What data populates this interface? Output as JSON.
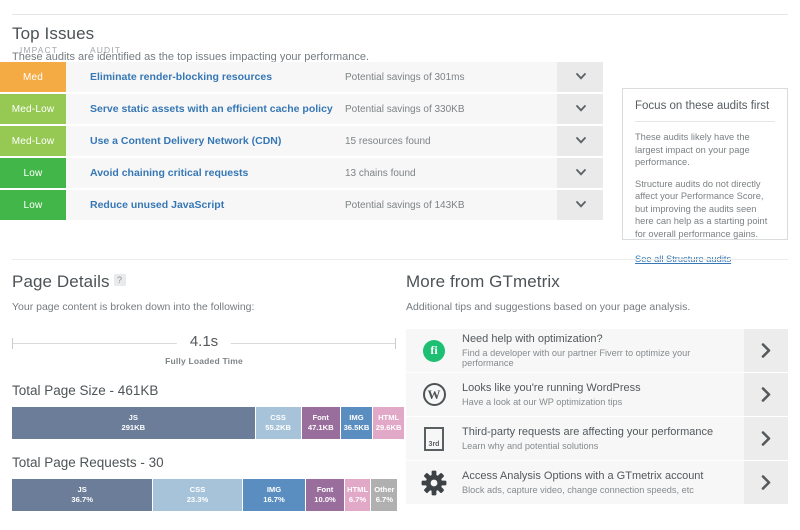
{
  "top_issues": {
    "title": "Top Issues",
    "subtitle": "These audits are identified as the top issues impacting your performance.",
    "columns": {
      "impact": "IMPACT",
      "audit": "AUDIT"
    },
    "rows": [
      {
        "impact": "Med",
        "impact_color": "#f4ab44",
        "audit": "Eliminate render-blocking resources",
        "value": "Potential savings of 301ms",
        "chevron": "chevron-down-icon"
      },
      {
        "impact": "Med-Low",
        "impact_color": "#96c954",
        "audit": "Serve static assets with an efficient cache policy",
        "value": "Potential savings of 330KB",
        "chevron": "chevron-down-icon"
      },
      {
        "impact": "Med-Low",
        "impact_color": "#96c954",
        "audit": "Use a Content Delivery Network (CDN)",
        "value": "15 resources found",
        "chevron": "chevron-down-icon"
      },
      {
        "impact": "Low",
        "impact_color": "#43b649",
        "audit": "Avoid chaining critical requests",
        "value": "13 chains found",
        "chevron": "chevron-down-icon"
      },
      {
        "impact": "Low",
        "impact_color": "#43b649",
        "audit": "Reduce unused JavaScript",
        "value": "Potential savings of 143KB",
        "chevron": "chevron-down-icon"
      }
    ]
  },
  "focus_box": {
    "title": "Focus on these audits first",
    "paragraph1": "These audits likely have the largest impact on your page performance.",
    "paragraph2": "Structure audits do not directly affect your Performance Score, but improving the audits seen here can help as a starting point for overall performance gains.",
    "link": "See all Structure audits"
  },
  "page_details": {
    "title": "Page Details",
    "help_glyph": "?",
    "subtitle": "Your page content is broken down into the following:",
    "fully_loaded_value": "4.1s",
    "fully_loaded_label": "Fully Loaded Time",
    "size_title": "Total Page Size - 461KB",
    "requests_title": "Total Page Requests - 30"
  },
  "more": {
    "title": "More from GTmetrix",
    "subtitle": "Additional tips and suggestions based on your page analysis.",
    "items": [
      {
        "icon": "fiverr-icon",
        "icon_glyph": "fi",
        "title": "Need help with optimization?",
        "sub": "Find a developer with our partner Fiverr to optimize your performance",
        "arrow": "chevron-right-icon"
      },
      {
        "icon": "wordpress-icon",
        "icon_glyph": "W",
        "title": "Looks like you're running WordPress",
        "sub": "Have a look at our WP optimization tips",
        "arrow": "chevron-right-icon"
      },
      {
        "icon": "third-party-icon",
        "icon_glyph": "3rd",
        "title": "Third-party requests are affecting your performance",
        "sub": "Learn why and potential solutions",
        "arrow": "chevron-right-icon"
      },
      {
        "icon": "gear-icon",
        "icon_glyph": "",
        "title": "Access Analysis Options with a GTmetrix account",
        "sub": "Block ads, capture video, change connection speeds, etc",
        "arrow": "chevron-right-icon"
      }
    ]
  },
  "chart_data": [
    {
      "type": "bar",
      "orientation": "stacked-horizontal",
      "title": "Total Page Size - 461KB",
      "total": "461KB",
      "unit": "KB",
      "categories": [
        "JS",
        "CSS",
        "Font",
        "IMG",
        "HTML"
      ],
      "values": [
        291,
        55.2,
        47.1,
        36.5,
        29.6
      ],
      "value_labels": [
        "291KB",
        "55.2KB",
        "47.1KB",
        "36.5KB",
        "29.6KB"
      ],
      "colors": [
        "#6b7d98",
        "#a6c3da",
        "#9a6e9c",
        "#5b8ec0",
        "#e2a8c8"
      ],
      "xlabel": "",
      "ylabel": "",
      "grid": false,
      "legend": "none"
    },
    {
      "type": "bar",
      "orientation": "stacked-horizontal",
      "title": "Total Page Requests - 30",
      "total": "30",
      "unit": "%",
      "categories": [
        "JS",
        "CSS",
        "IMG",
        "Font",
        "HTML",
        "Other"
      ],
      "values": [
        36.7,
        23.3,
        16.7,
        10.0,
        6.7,
        6.7
      ],
      "value_labels": [
        "36.7%",
        "23.3%",
        "16.7%",
        "10.0%",
        "6.7%",
        "6.7%"
      ],
      "colors": [
        "#6b7d98",
        "#a6c3da",
        "#5b8ec0",
        "#9a6e9c",
        "#e2a8c8",
        "#b0b0b0"
      ],
      "xlabel": "",
      "ylabel": "",
      "grid": false,
      "legend": "none"
    },
    {
      "type": "table",
      "title": "Fully Loaded Time",
      "categories": [
        "Fully Loaded Time"
      ],
      "values": [
        4.1
      ],
      "value_labels": [
        "4.1s"
      ]
    }
  ]
}
